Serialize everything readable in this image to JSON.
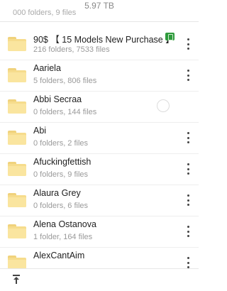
{
  "header": {
    "storage_size": "5.97 TB",
    "partial_text": "000 folders, 9 files"
  },
  "items": [
    {
      "name": "90$ 【 15 Models New Purchase 】",
      "meta": "216 folders, 7533 files",
      "badge": "cash-icon"
    },
    {
      "name": "Aariela",
      "meta": "5 folders, 806 files"
    },
    {
      "name": "Abbi Secraa",
      "meta": "0 folders, 144 files",
      "loading": true
    },
    {
      "name": "Abi",
      "meta": "0 folders, 2 files"
    },
    {
      "name": "Afuckingfettish",
      "meta": "0 folders, 9 files"
    },
    {
      "name": "Alaura Grey",
      "meta": "0 folders, 6 files"
    },
    {
      "name": "Alena Ostanova",
      "meta": "1 folder, 164 files"
    },
    {
      "name": "AlexCantAim",
      "meta": ""
    }
  ],
  "colors": {
    "folder": "#f6dc8c",
    "badge": "#2e9a3c"
  }
}
